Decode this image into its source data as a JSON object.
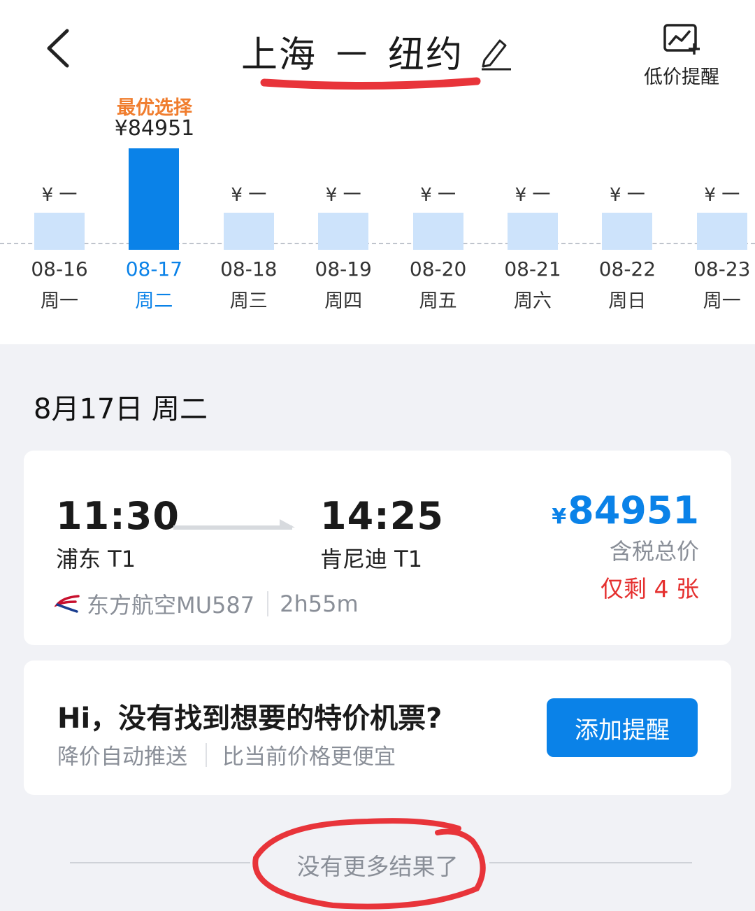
{
  "header": {
    "origin": "上海",
    "separator": "一",
    "destination": "纽约",
    "alert_label": "低价提醒"
  },
  "price_calendar": {
    "best_label": "最优选择",
    "best_price": "¥84951",
    "days": [
      {
        "date": "08-16",
        "weekday": "周一",
        "price": "¥ 一",
        "selected": false
      },
      {
        "date": "08-17",
        "weekday": "周二",
        "price": "",
        "selected": true
      },
      {
        "date": "08-18",
        "weekday": "周三",
        "price": "¥ 一",
        "selected": false
      },
      {
        "date": "08-19",
        "weekday": "周四",
        "price": "¥ 一",
        "selected": false
      },
      {
        "date": "08-20",
        "weekday": "周五",
        "price": "¥ 一",
        "selected": false
      },
      {
        "date": "08-21",
        "weekday": "周六",
        "price": "¥ 一",
        "selected": false
      },
      {
        "date": "08-22",
        "weekday": "周日",
        "price": "¥ 一",
        "selected": false
      },
      {
        "date": "08-23",
        "weekday": "周一",
        "price": "¥ 一",
        "selected": false
      }
    ]
  },
  "selected_date": "8月17日 周二",
  "flight": {
    "dep_time": "11:30",
    "dep_airport": "浦东 T1",
    "arr_time": "14:25",
    "arr_airport": "肯尼迪 T1",
    "currency": "¥",
    "price": "84951",
    "price_note": "含税总价",
    "remaining": "仅剩 4 张",
    "airline": "东方航空MU587",
    "duration": "2h55m"
  },
  "promo": {
    "title": "Hi，没有找到想要的特价机票?",
    "sub1": "降价自动推送",
    "sub2": "比当前价格更便宜",
    "button": "添加提醒"
  },
  "end_text": "没有更多结果了",
  "colors": {
    "accent": "#0a82e8",
    "best_label": "#f07d2e",
    "remaining": "#e5302f",
    "bar_light": "#cde3fb",
    "annotation_red": "#e8343a"
  }
}
